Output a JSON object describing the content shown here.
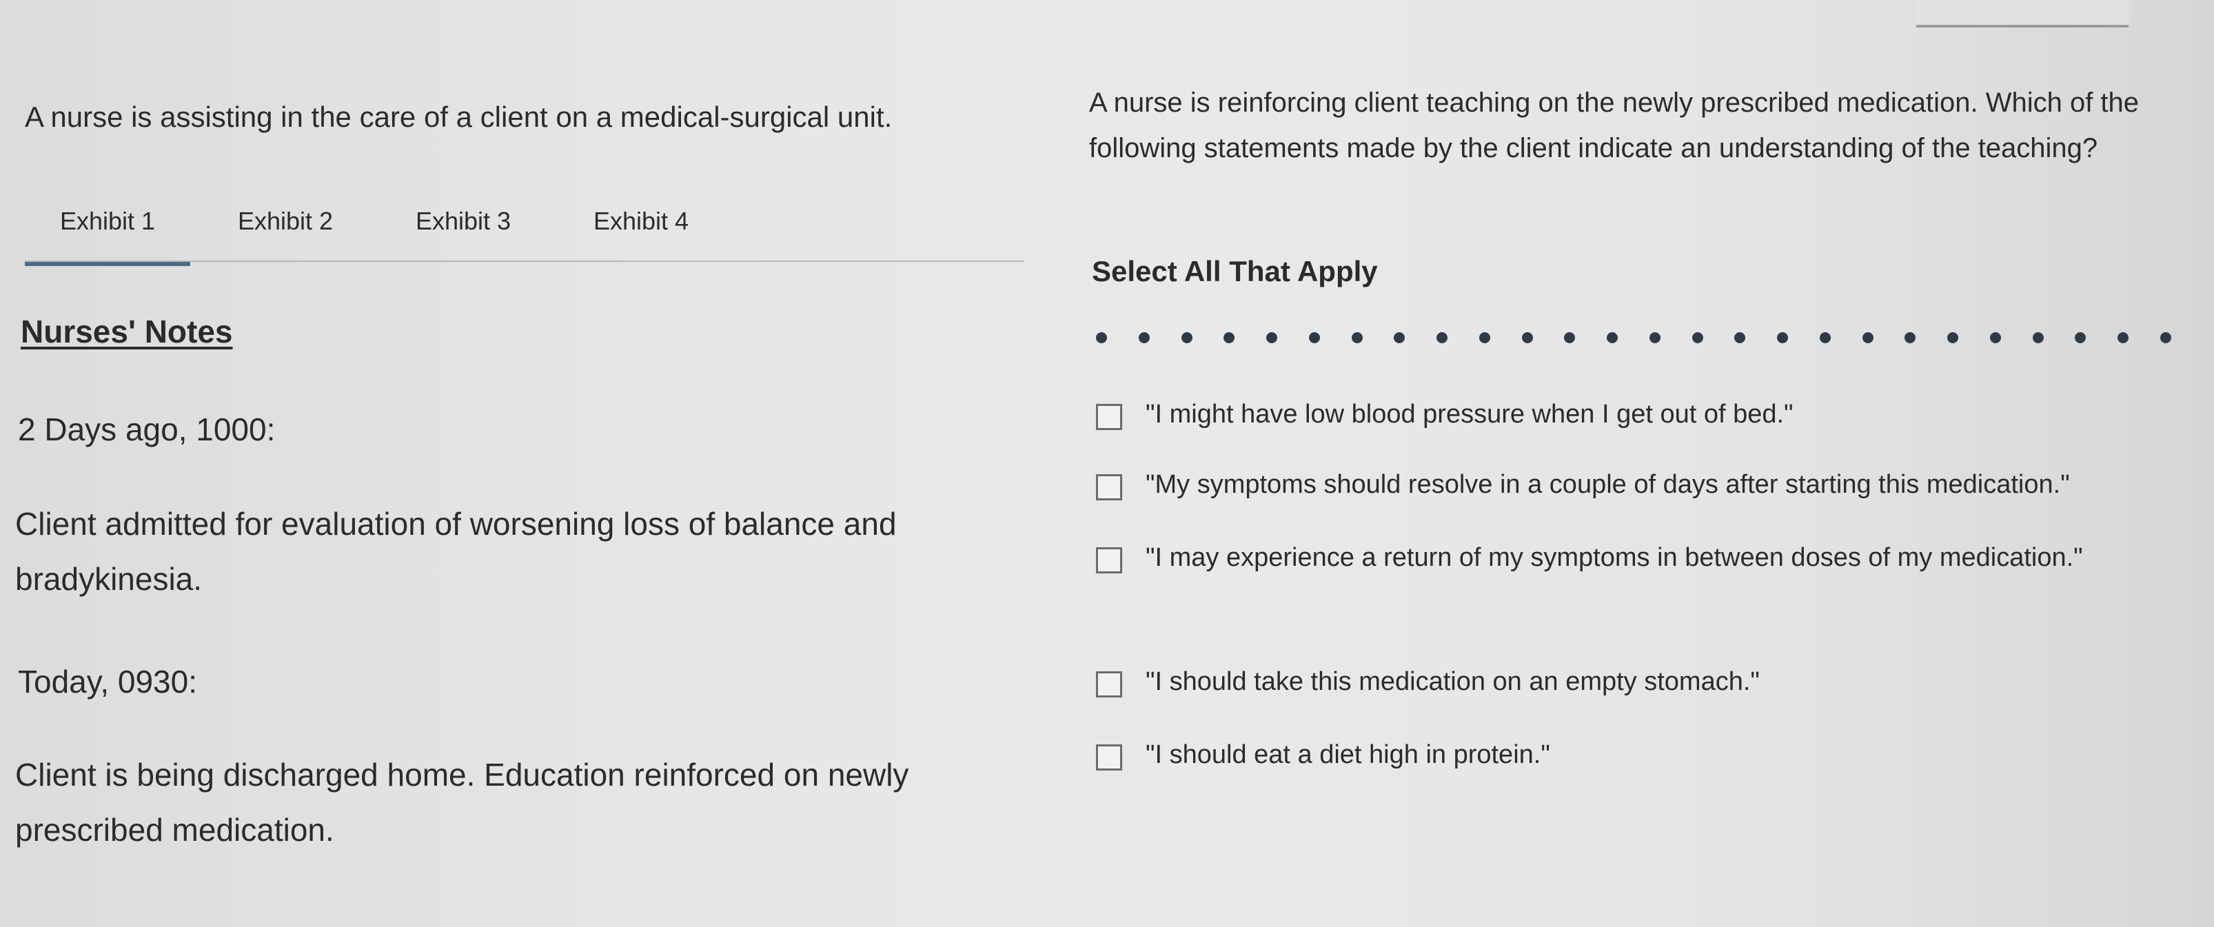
{
  "stem": "A nurse is assisting in the care of a client on a medical-surgical unit.",
  "tabs": [
    {
      "label": "Exhibit 1",
      "active": true
    },
    {
      "label": "Exhibit 2",
      "active": false
    },
    {
      "label": "Exhibit 3",
      "active": false
    },
    {
      "label": "Exhibit 4",
      "active": false
    }
  ],
  "notes": {
    "heading": "Nurses' Notes",
    "entries": [
      {
        "time": "2 Days ago, 1000:",
        "text": "Client admitted for evaluation of worsening loss of balance and bradykinesia."
      },
      {
        "time": "Today, 0930:",
        "text": "Client is being discharged home. Education reinforced on newly prescribed medication."
      }
    ]
  },
  "question": {
    "text": "A nurse is reinforcing client teaching on the newly prescribed medication. Which of the following statements made by the client indicate an understanding of the teaching?",
    "instruction": "Select All That Apply",
    "dot_count": 26,
    "options": [
      {
        "label": "\"I might have low blood pressure when I get out of bed.\"",
        "checked": false
      },
      {
        "label": "\"My symptoms should resolve in a couple of days after starting this medication.\"",
        "checked": false
      },
      {
        "label": "\"I may experience a return of my symptoms in between doses of my medication.\"",
        "checked": false
      },
      {
        "label": "\"I should take this medication on an empty stomach.\"",
        "checked": false
      },
      {
        "label": "\"I should eat a diet high in protein.\"",
        "checked": false
      }
    ]
  },
  "colors": {
    "tab_underline": "#4c6a8a",
    "dot": "#2f3a49",
    "text": "#2b2b2b"
  }
}
